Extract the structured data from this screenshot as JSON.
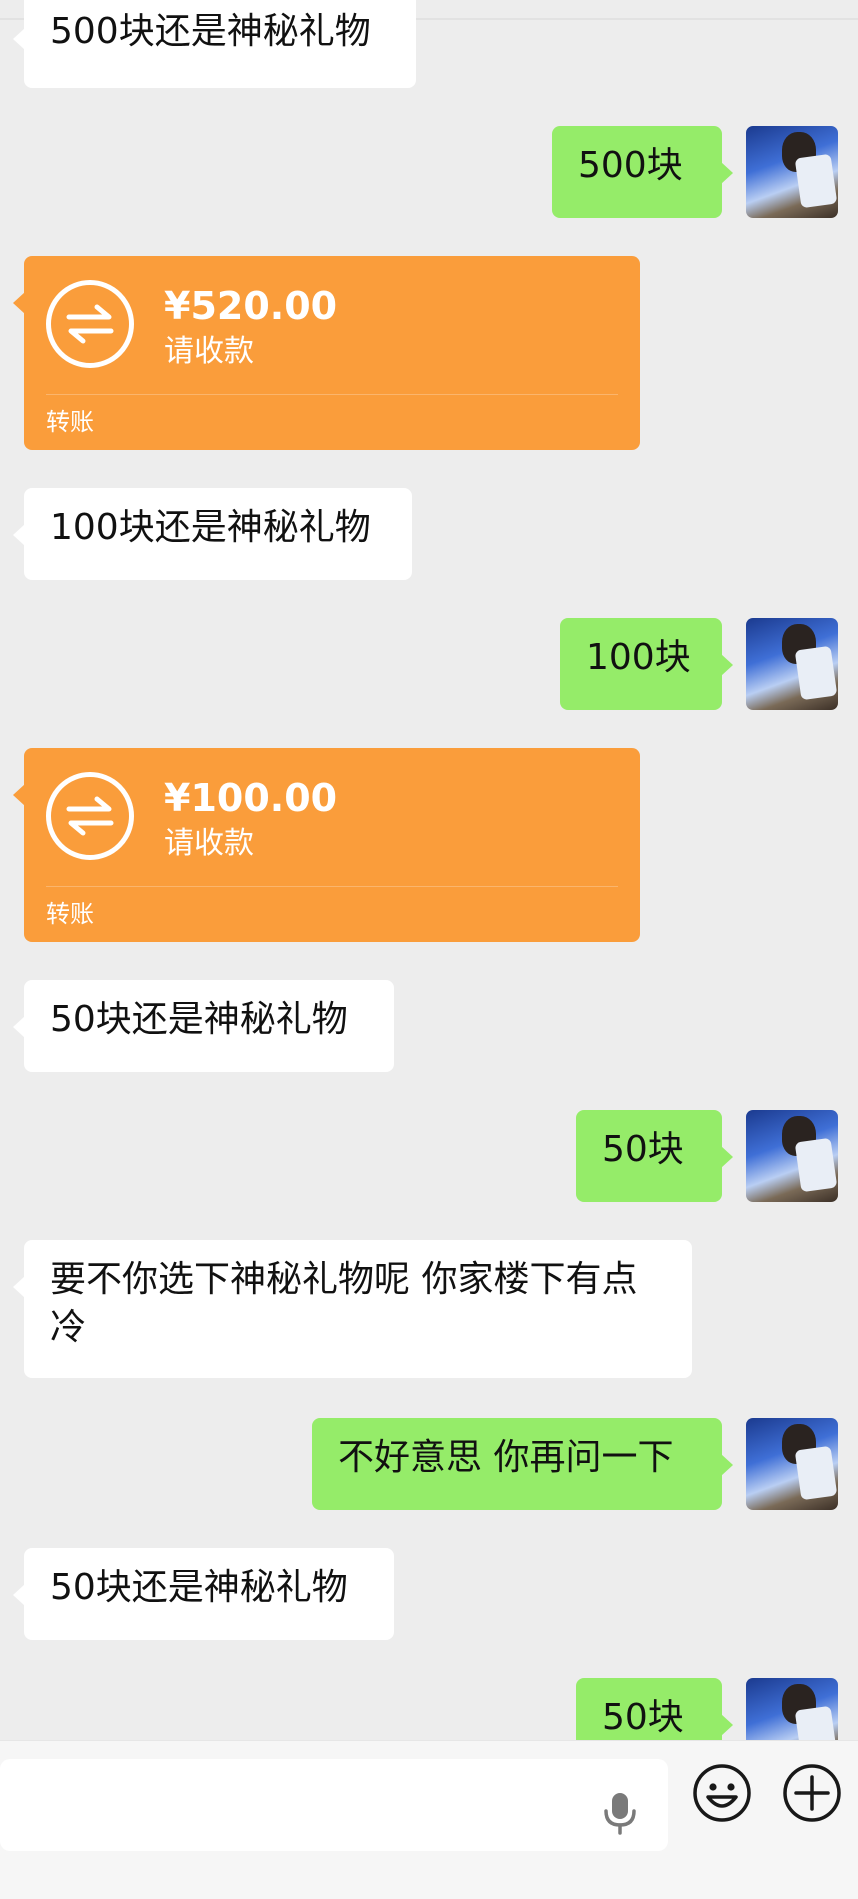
{
  "messages": [
    {
      "type": "text",
      "side": "in",
      "text": "500块还是神秘礼物"
    },
    {
      "type": "text",
      "side": "out",
      "text": "500块"
    },
    {
      "type": "transfer",
      "side": "in",
      "amount": "¥520.00",
      "status": "请收款",
      "label": "转账"
    },
    {
      "type": "text",
      "side": "in",
      "text": "100块还是神秘礼物"
    },
    {
      "type": "text",
      "side": "out",
      "text": "100块"
    },
    {
      "type": "transfer",
      "side": "in",
      "amount": "¥100.00",
      "status": "请收款",
      "label": "转账"
    },
    {
      "type": "text",
      "side": "in",
      "text": "50块还是神秘礼物"
    },
    {
      "type": "text",
      "side": "out",
      "text": "50块"
    },
    {
      "type": "text",
      "side": "in",
      "text": "要不你选下神秘礼物呢 你家楼下有点冷"
    },
    {
      "type": "text",
      "side": "out",
      "text": "不好意思 你再问一下"
    },
    {
      "type": "text",
      "side": "in",
      "text": "50块还是神秘礼物"
    },
    {
      "type": "text",
      "side": "out",
      "text": "50块"
    }
  ],
  "colors": {
    "background": "#ededed",
    "incoming_bubble": "#ffffff",
    "outgoing_bubble": "#95ec69",
    "transfer_card": "#fa9d3b"
  },
  "icons": {
    "voice": "microphone-icon",
    "emoji": "emoji-face-icon",
    "more": "plus-circle-icon",
    "transfer": "transfer-arrows-icon"
  },
  "input": {
    "value": ""
  }
}
